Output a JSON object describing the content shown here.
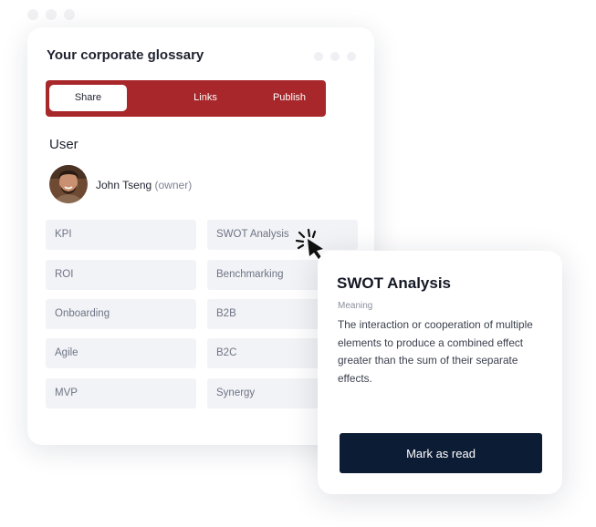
{
  "glossary": {
    "title": "Your corporate glossary",
    "tabs": [
      {
        "label": "Share",
        "active": true
      },
      {
        "label": "Links",
        "active": false
      },
      {
        "label": "Publish",
        "active": false
      }
    ],
    "user_section": {
      "heading": "User",
      "user": {
        "name": "John Tseng",
        "role": "(owner)"
      }
    },
    "terms_left": [
      "KPI",
      "ROI",
      "Onboarding",
      "Agile",
      "MVP"
    ],
    "terms_right": [
      "SWOT Analysis",
      "Benchmarking",
      "B2B",
      "B2C",
      "Synergy"
    ]
  },
  "detail": {
    "title": "SWOT Analysis",
    "label": "Meaning",
    "definition": "The interaction or cooperation of multiple elements to produce a combined effect greater than the sum of their separate effects.",
    "button_label": "Mark as read"
  },
  "colors": {
    "accent": "#a8272a",
    "button": "#0c1c35",
    "term_bg": "#f2f3f6"
  }
}
